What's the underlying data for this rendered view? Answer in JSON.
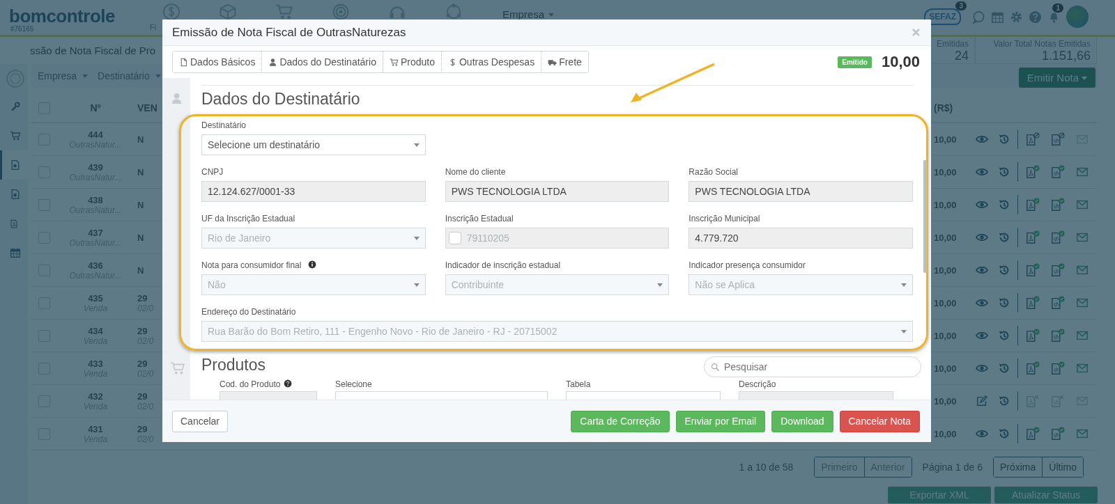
{
  "header": {
    "logo": "bomcontrole",
    "account": "#76165",
    "nav_label": "Fi",
    "company_menu": "Empresa",
    "sefaz": {
      "label": "SEFAZ",
      "count": "3"
    },
    "notifications_count": "1"
  },
  "page_title": "ssão de Nota Fiscal de Pro",
  "stats": [
    {
      "label": "Emitidas",
      "value": "24"
    },
    {
      "label": "Valor Total Notas Emitidas",
      "value": "1.151,66"
    }
  ],
  "filters": [
    "Empresa",
    "Destinatário"
  ],
  "emit_button": "Emitir Nota",
  "sidebar": [
    {
      "selected": false
    },
    {
      "selected": false
    },
    {
      "selected": false
    },
    {
      "selected": true
    },
    {
      "selected": false
    },
    {
      "selected": false
    },
    {
      "selected": false
    }
  ],
  "table": {
    "columns": [
      "Nº",
      "VEN",
      "(R$)"
    ],
    "all_checked": false,
    "rows": [
      {
        "checked": false,
        "number": "444",
        "type": "OutrasNatur...",
        "column_3": "N",
        "value": "10,00",
        "kind": "view",
        "issued": true,
        "canceled": true,
        "email_enabled": false
      },
      {
        "checked": false,
        "number": "439",
        "type": "OutrasNatur...",
        "column_3": "N",
        "value": "10,00",
        "kind": "view",
        "issued": true,
        "canceled": false,
        "email_enabled": true
      },
      {
        "checked": false,
        "number": "438",
        "type": "OutrasNatur...",
        "column_3": "N",
        "value": "10,00",
        "kind": "view",
        "issued": true,
        "canceled": false,
        "email_enabled": true
      },
      {
        "checked": false,
        "number": "437",
        "type": "OutrasNatur...",
        "column_3": "N",
        "value": "10,00",
        "kind": "view",
        "issued": true,
        "canceled": false,
        "email_enabled": true
      },
      {
        "checked": false,
        "number": "436",
        "type": "OutrasNatur...",
        "column_3": "N",
        "value": "10,00",
        "kind": "view",
        "issued": true,
        "canceled": false,
        "email_enabled": true
      },
      {
        "checked": false,
        "number": "435",
        "type": "Venda",
        "column_3": "29",
        "column_3_sub": "02/0",
        "value": "10,00",
        "kind": "view",
        "issued": true,
        "canceled": false,
        "email_enabled": true
      },
      {
        "checked": false,
        "number": "434",
        "type": "Venda",
        "column_3": "29",
        "column_3_sub": "02/0",
        "value": "10,00",
        "kind": "view",
        "issued": true,
        "canceled": false,
        "email_enabled": true
      },
      {
        "checked": false,
        "number": "433",
        "type": "Venda",
        "column_3": "29",
        "column_3_sub": "02/0",
        "value": "10,00",
        "kind": "view",
        "issued": true,
        "canceled": false,
        "email_enabled": true
      },
      {
        "checked": false,
        "number": "432",
        "type": "Venda",
        "column_3": "29",
        "column_3_sub": "02/0",
        "value": "10,00",
        "kind": "edit",
        "issued": false,
        "canceled": false,
        "email_enabled": false
      },
      {
        "checked": false,
        "number": "431",
        "type": "Venda",
        "column_3": "29",
        "column_3_sub": "02/0",
        "value": "10,00",
        "kind": "view",
        "issued": true,
        "canceled": false,
        "email_enabled": true
      }
    ]
  },
  "pagination": {
    "summary": "1 a 10 de 58",
    "page": "Página 1 de 6",
    "prev": [
      {
        "label": "Primeiro",
        "disabled": true
      },
      {
        "label": "Anterior",
        "disabled": true
      }
    ],
    "next": [
      {
        "label": "Próxima",
        "disabled": false
      },
      {
        "label": "Último",
        "disabled": false
      }
    ]
  },
  "bottom_buttons": [
    "Exportar XML",
    "Atualizar Status"
  ],
  "modal": {
    "title": "Emissão de Nota Fiscal de OutrasNaturezas",
    "tabs": [
      "Dados Básicos",
      "Dados do Destinatário",
      "Produto",
      "Outras Despesas",
      "Frete"
    ],
    "status": "Emitido",
    "total": "10,00",
    "recipient": {
      "title": "Dados do Destinatário",
      "recipient_select": {
        "label": "Destinatário",
        "value": "Selecione um destinatário",
        "kind": "select",
        "disabled": false
      },
      "fields": [
        {
          "label": "CNPJ",
          "value": "12.124.627/0001-33",
          "kind": "text",
          "disabled": false,
          "help": false
        },
        {
          "label": "Nome do cliente",
          "value": "PWS TECNOLOGIA LTDA",
          "kind": "text",
          "disabled": false,
          "help": false
        },
        {
          "label": "Razão Social",
          "value": "PWS TECNOLOGIA LTDA",
          "kind": "text",
          "disabled": false,
          "help": false
        },
        {
          "label": "UF da Inscrição Estadual",
          "value": "Rio de Janeiro",
          "kind": "select",
          "disabled": true,
          "help": false
        },
        {
          "label": "Inscrição Estadual",
          "value": "79110205",
          "kind": "checkbox_text",
          "disabled": true,
          "checked": false,
          "help": false
        },
        {
          "label": "Inscrição Municipal",
          "value": "4.779.720",
          "kind": "text",
          "disabled": false,
          "help": false
        },
        {
          "label": "Nota para consumidor final",
          "value": "Não",
          "kind": "select",
          "disabled": true,
          "help": true
        },
        {
          "label": "Indicador de inscrição estadual",
          "value": "Contribuinte",
          "kind": "select",
          "disabled": true,
          "help": false
        },
        {
          "label": "Indicador presença consumidor",
          "value": "Não se Aplica",
          "kind": "select",
          "disabled": true,
          "help": false
        }
      ],
      "address": {
        "label": "Endereço do Destinatário",
        "value": "Rua Barão do Bom Retiro, 111 - Engenho Novo - Rio de Janeiro - RJ - 20715002",
        "kind": "select",
        "disabled": true
      }
    },
    "products": {
      "title": "Produtos",
      "search_placeholder": "Pesquisar",
      "columns": [
        {
          "label": "Cod. do Produto",
          "help": true
        },
        {
          "label": "Selecione",
          "help": false
        },
        {
          "label": "Tabela",
          "help": false
        },
        {
          "label": "Descrição",
          "help": false
        }
      ]
    },
    "cancel": "Cancelar",
    "actions": [
      {
        "label": "Carta de Correção",
        "kind": "success"
      },
      {
        "label": "Enviar por Email",
        "kind": "success"
      },
      {
        "label": "Download",
        "kind": "success"
      },
      {
        "label": "Cancelar Nota",
        "kind": "danger"
      }
    ]
  }
}
